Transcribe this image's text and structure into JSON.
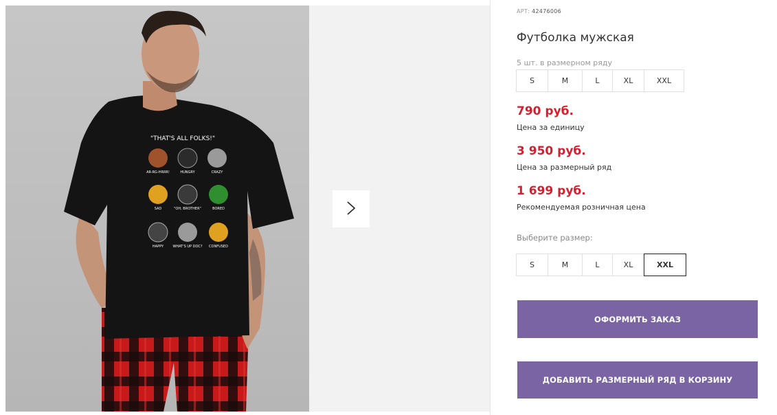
{
  "product": {
    "sku_label": "АРТ:",
    "sku_value": "42476006",
    "title": "Футболка мужская",
    "row_note": "5 шт. в размерном ряду"
  },
  "size_row": [
    "S",
    "M",
    "L",
    "XL",
    "XXL"
  ],
  "prices": {
    "unit_price": "790 руб.",
    "unit_label": "Цена за единицу",
    "row_price": "3 950 руб.",
    "row_label": "Цена за размерный ряд",
    "retail_price": "1 699 руб.",
    "retail_label": "Рекомендуемая розничная цена"
  },
  "size_select": {
    "label": "Выберите размер:",
    "options": [
      "S",
      "M",
      "L",
      "XL",
      "XXL"
    ],
    "selected": "XXL"
  },
  "buttons": {
    "order": "ОФОРМИТЬ ЗАКАЗ",
    "add_row": "ДОБАВИТЬ РАЗМЕРНЫЙ РЯД В КОРЗИНУ"
  },
  "tshirt_print": {
    "headline": "\"THAT'S ALL FOLKS!\"",
    "captions": [
      "AR-RG-HRRR!",
      "HUNGRY",
      "CRAZY",
      "SAD",
      "\"OH, BROTHER\"",
      "BORED",
      "HAPPY",
      "WHAT'S UP DOC?",
      "CONFUSED"
    ]
  },
  "colors": {
    "accent_button": "#7a64a3",
    "price": "#d81e2e",
    "gallery_bg": "#f2f2f2"
  },
  "icons": {
    "next_arrow": "chevron-right-icon"
  }
}
